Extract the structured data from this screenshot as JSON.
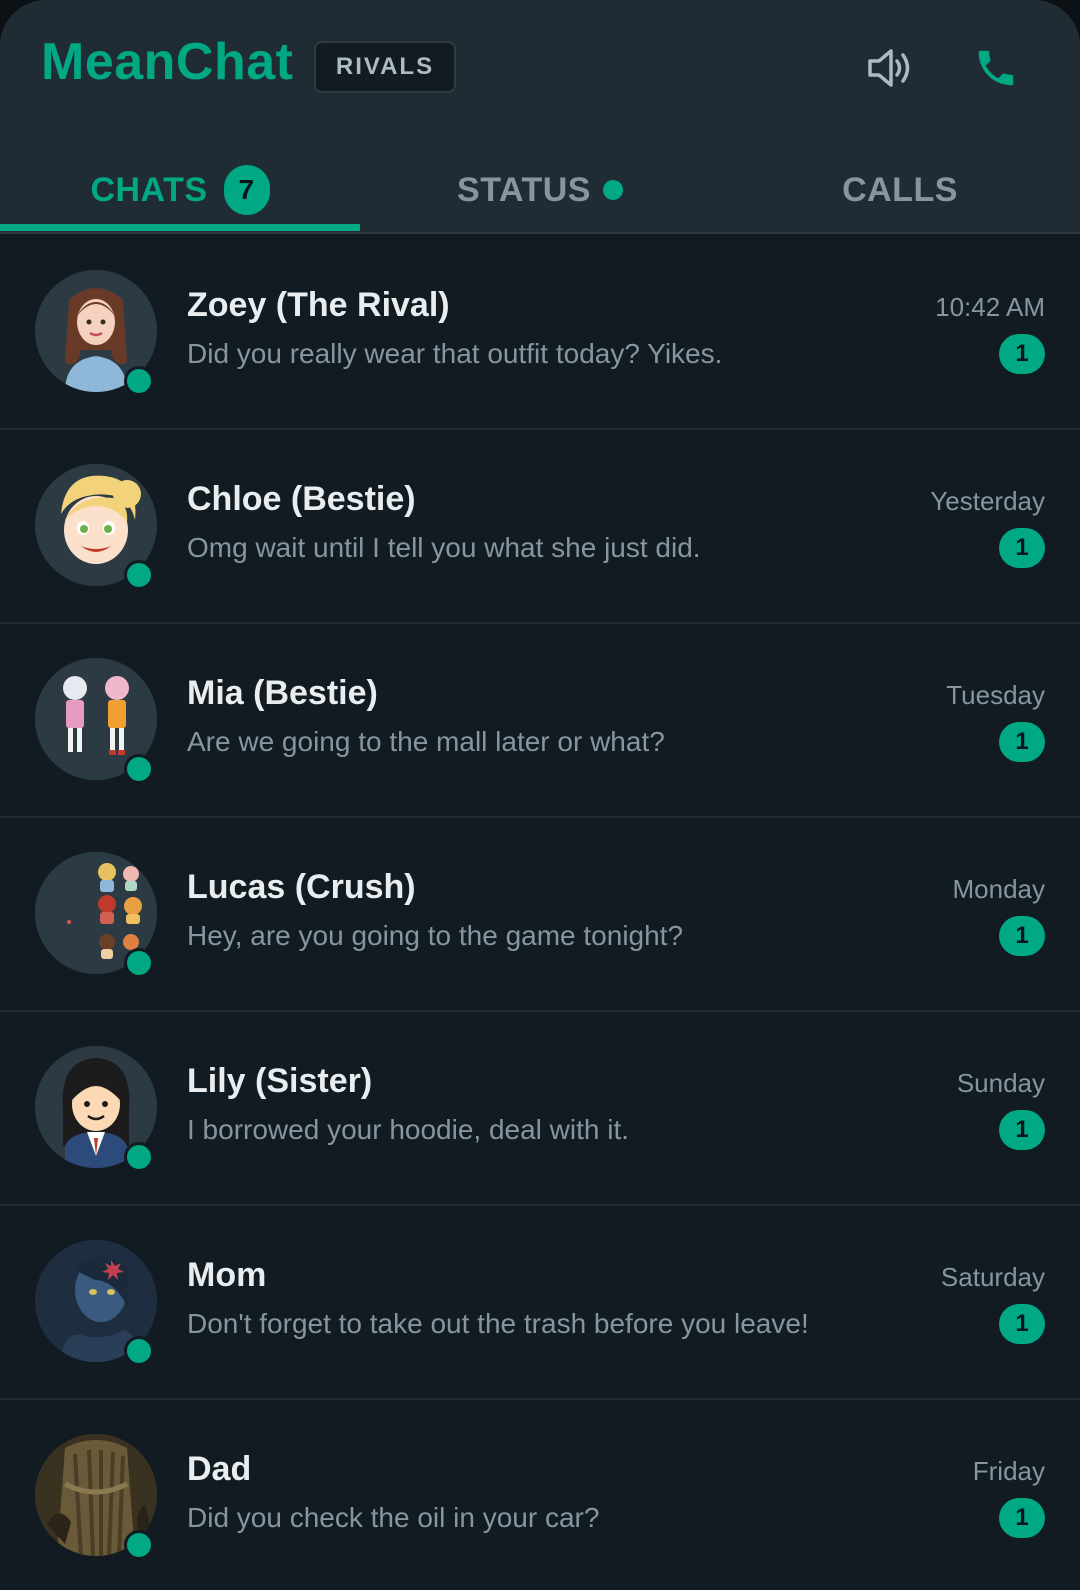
{
  "header": {
    "app_name": "MeanChat",
    "tag": "RIVALS",
    "icons": [
      "speaker-icon",
      "phone-icon"
    ],
    "accent_color": "#00a884"
  },
  "tabs": [
    {
      "label": "CHATS",
      "count": "7",
      "active": true
    },
    {
      "label": "STATUS",
      "has_dot": true
    },
    {
      "label": "CALLS"
    }
  ],
  "chats": [
    {
      "name": "Zoey (The Rival)",
      "preview": "Did you really wear that outfit today? Yikes.",
      "time": "10:42 AM",
      "unread": "1",
      "online": true
    },
    {
      "name": "Chloe (Bestie)",
      "preview": "Omg wait until I tell you what she just did.",
      "time": "Yesterday",
      "unread": "1",
      "online": true
    },
    {
      "name": "Mia (Bestie)",
      "preview": "Are we going to the mall later or what?",
      "time": "Tuesday",
      "unread": "1",
      "online": true
    },
    {
      "name": "Lucas (Crush)",
      "preview": "Hey, are you going to the game tonight?",
      "time": "Monday",
      "unread": "1",
      "online": true
    },
    {
      "name": "Lily (Sister)",
      "preview": "I borrowed your hoodie, deal with it.",
      "time": "Sunday",
      "unread": "1",
      "online": true
    },
    {
      "name": "Mom",
      "preview": "Don't forget to take out the trash before you leave!",
      "time": "Saturday",
      "unread": "1",
      "online": true
    },
    {
      "name": "Dad",
      "preview": "Did you check the oil in your car?",
      "time": "Friday",
      "unread": "1",
      "online": true
    }
  ]
}
